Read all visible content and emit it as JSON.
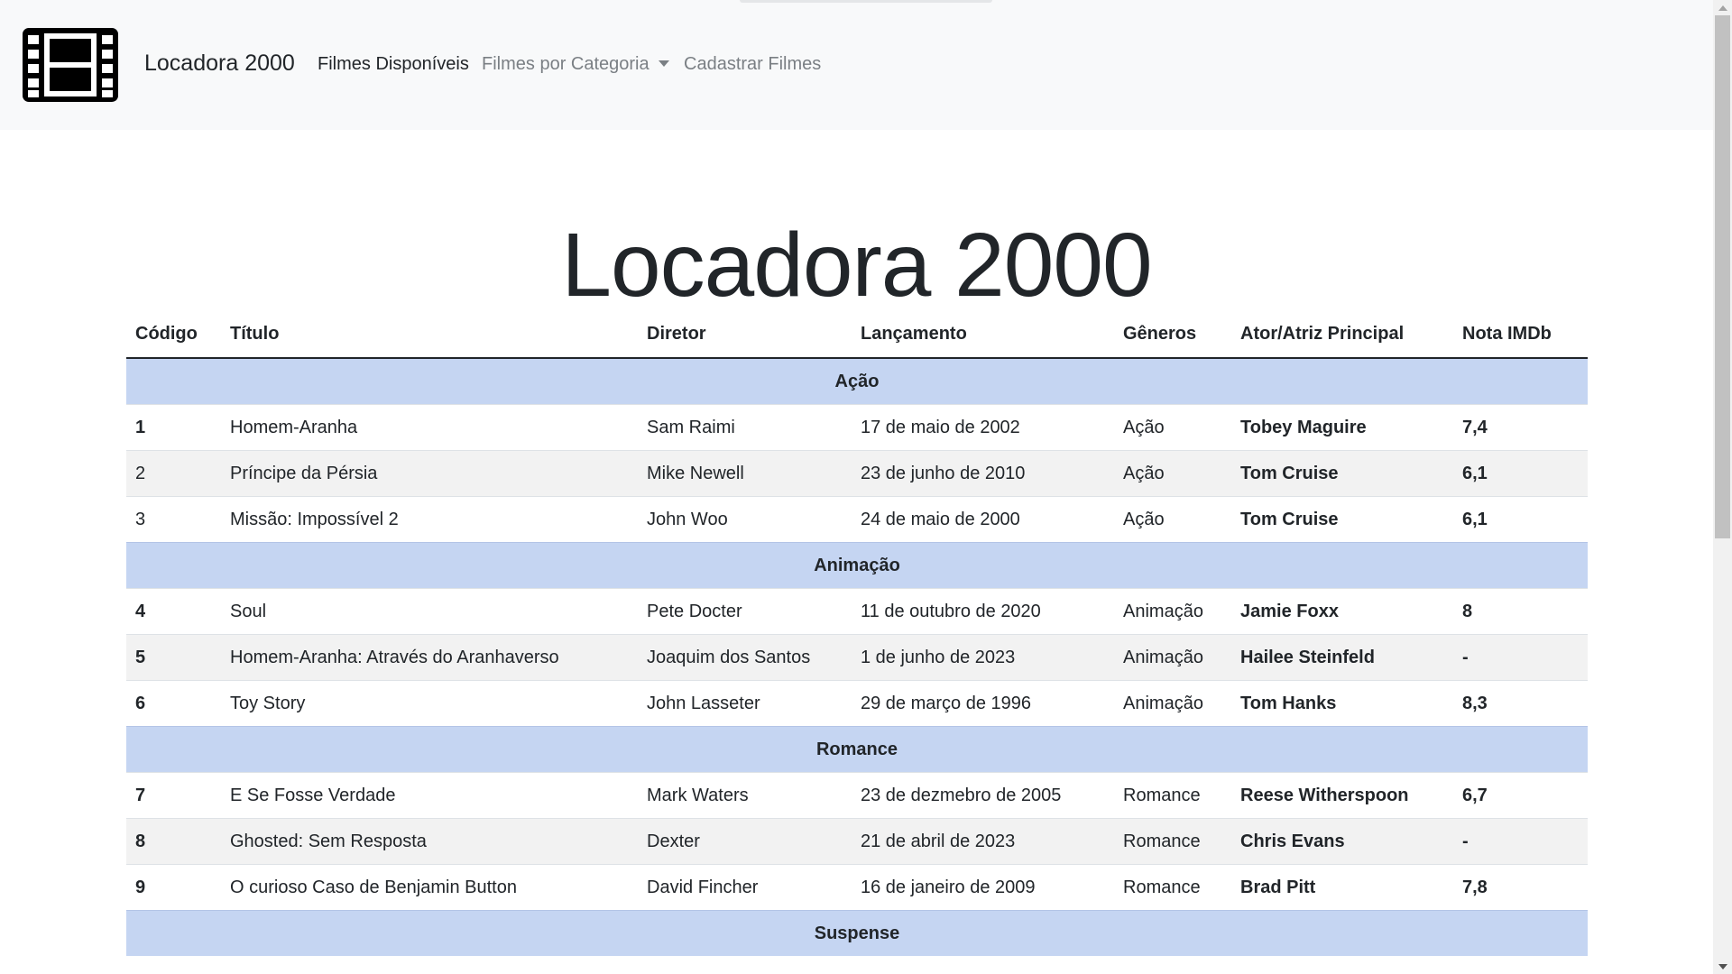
{
  "navbar": {
    "brand": "Locadora 2000",
    "links": {
      "available": "Filmes Disponíveis",
      "category": "Filmes por Categoria",
      "register": "Cadastrar Filmes"
    }
  },
  "main": {
    "title": "Locadora 2000"
  },
  "table": {
    "headers": {
      "code": "Código",
      "title": "Título",
      "director": "Diretor",
      "release": "Lançamento",
      "genres": "Gêneros",
      "actor": "Ator/Atriz Principal",
      "rating": "Nota IMDb"
    },
    "groups": [
      {
        "category": "Ação",
        "rows": [
          {
            "code": "1",
            "title": "Homem-Aranha",
            "director": "Sam Raimi",
            "release": "17 de maio de 2002",
            "genre": "Ação",
            "actor": "Tobey Maguire",
            "rating": "7,4"
          },
          {
            "code": "2",
            "title": "Príncipe da Pérsia",
            "director": "Mike Newell",
            "release": "23 de junho de 2010",
            "genre": "Ação",
            "actor": "Tom Cruise",
            "rating": "6,1"
          },
          {
            "code": "3",
            "title": "Missão: Impossível 2",
            "director": "John Woo",
            "release": "24 de maio de 2000",
            "genre": "Ação",
            "actor": "Tom Cruise",
            "rating": "6,1"
          }
        ]
      },
      {
        "category": "Animação",
        "rows": [
          {
            "code": "4",
            "title": "Soul",
            "director": "Pete Docter",
            "release": "11 de outubro de 2020",
            "genre": "Animação",
            "actor": "Jamie Foxx",
            "rating": "8"
          },
          {
            "code": "5",
            "title": "Homem-Aranha: Através do Aranhaverso",
            "director": "Joaquim dos Santos",
            "release": "1 de junho de 2023",
            "genre": "Animação",
            "actor": "Hailee Steinfeld",
            "rating": "-"
          },
          {
            "code": "6",
            "title": "Toy Story",
            "director": "John Lasseter",
            "release": "29 de março de 1996",
            "genre": "Animação",
            "actor": "Tom Hanks",
            "rating": "8,3"
          }
        ]
      },
      {
        "category": "Romance",
        "rows": [
          {
            "code": "7",
            "title": "E Se Fosse Verdade",
            "director": "Mark Waters",
            "release": "23 de dezmebro de 2005",
            "genre": "Romance",
            "actor": "Reese Witherspoon",
            "rating": "6,7"
          },
          {
            "code": "8",
            "title": "Ghosted: Sem Resposta",
            "director": "Dexter",
            "release": "21 de abril de 2023",
            "genre": "Romance",
            "actor": "Chris Evans",
            "rating": "-"
          },
          {
            "code": "9",
            "title": "O curioso Caso de Benjamin Button",
            "director": "David Fincher",
            "release": "16 de janeiro de 2009",
            "genre": "Romance",
            "actor": "Brad Pitt",
            "rating": "7,8"
          }
        ]
      },
      {
        "category": "Suspense",
        "rows": []
      }
    ]
  },
  "icons": {
    "brand": "film-icon",
    "dropdown": "caret-down-icon"
  },
  "colors": {
    "navbar_bg": "#f8f9fa",
    "category_row_bg": "#c5d5f2",
    "striped_row_bg": "#f2f2f2",
    "muted_link": "#7a7f84"
  }
}
